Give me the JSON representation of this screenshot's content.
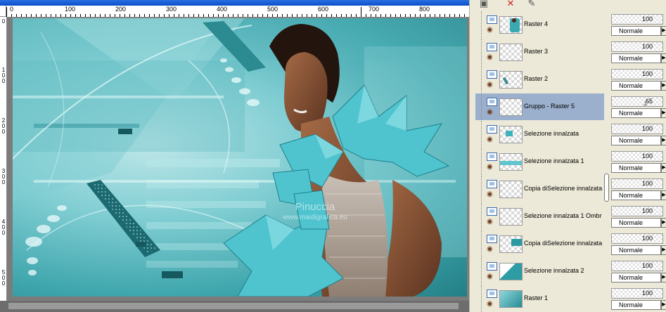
{
  "canvas": {
    "ruler_h_labels": [
      "100",
      "200",
      "300",
      "400",
      "500",
      "600",
      "700",
      "800"
    ],
    "ruler_v_labels": [
      "1\n0\n0",
      "2\n0\n0",
      "3\n0\n0",
      "4\n0\n0",
      "5\n0\n0"
    ],
    "ruler_v_zero": "0",
    "ruler_h_zero": "0",
    "watermark_line1": "Pinuccia",
    "watermark_line2": "www.maidigrafica.eu"
  },
  "layers_toolbar": {
    "icons": [
      "new-layer-icon",
      "delete-layer-icon",
      "mask-icon"
    ]
  },
  "layers": [
    {
      "name": "Raster 4",
      "opacity": "100",
      "blend": "Normale",
      "thumb": "figure",
      "selected": false
    },
    {
      "name": "Raster 3",
      "opacity": "100",
      "blend": "Normale",
      "thumb": "empty",
      "selected": false
    },
    {
      "name": "Raster 2",
      "opacity": "100",
      "blend": "Normale",
      "thumb": "dots",
      "selected": false
    },
    {
      "name": "Gruppo - Raster 5",
      "opacity": "65",
      "blend": "Normale",
      "thumb": "empty",
      "selected": true
    },
    {
      "name": "Selezione innalzata",
      "opacity": "100",
      "blend": "Normale",
      "thumb": "teal-small",
      "selected": false
    },
    {
      "name": "Selezione innalzata 1",
      "opacity": "100",
      "blend": "Normale",
      "thumb": "teal-strip",
      "selected": false
    },
    {
      "name": "Copia diSelezione innalzata",
      "opacity": "100",
      "blend": "Normale",
      "thumb": "empty",
      "selected": false
    },
    {
      "name": "Selezione innalzata 1 Ombr",
      "opacity": "100",
      "blend": "Normale",
      "thumb": "empty",
      "selected": false
    },
    {
      "name": "Copia diSelezione innalzata",
      "opacity": "100",
      "blend": "Normale",
      "thumb": "teal-corner",
      "selected": false
    },
    {
      "name": "Selezione innalzata 2",
      "opacity": "100",
      "blend": "Normale",
      "thumb": "teal-diag",
      "selected": false
    },
    {
      "name": "Raster 1",
      "opacity": "100",
      "blend": "Normale",
      "thumb": "teal-full",
      "selected": false
    }
  ],
  "colors": {
    "selected_row": "#9bb0cd",
    "teal_dark": "#237f86",
    "teal_light": "#bfe7e9",
    "origami": "#4fc4cf"
  }
}
